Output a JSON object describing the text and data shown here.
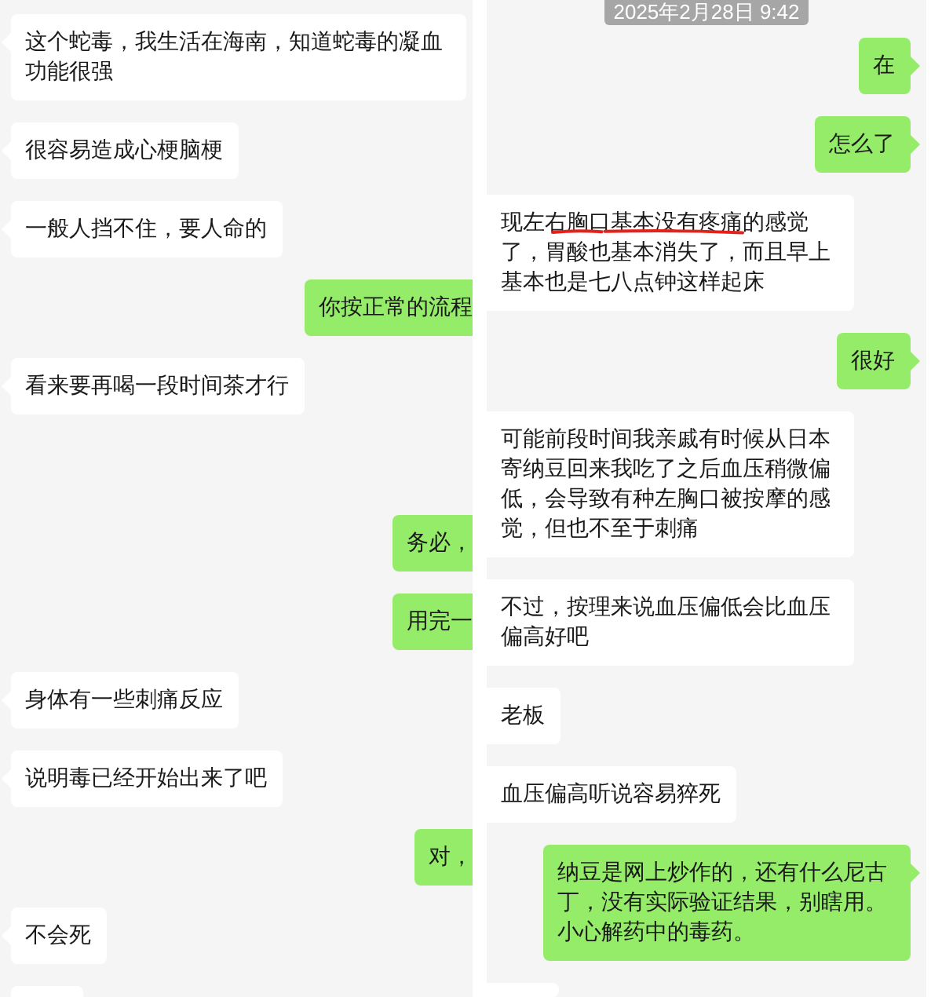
{
  "panels": [
    {
      "kind": "rightcut",
      "messages": [
        {
          "kind": "incoming",
          "text": "这个蛇毒，我生活在海南，知道蛇毒的凝血功能很强"
        },
        {
          "kind": "incoming",
          "text": "很容易造成心梗脑梗"
        },
        {
          "kind": "incoming",
          "text": "一般人挡不住，要人命的"
        },
        {
          "kind": "outgoing",
          "text": "你按正常的流程"
        },
        {
          "kind": "incoming",
          "text": "看来要再喝一段时间茶才行"
        },
        {
          "kind": "outgoing",
          "text": "务必，",
          "gap_before": true
        },
        {
          "kind": "outgoing",
          "text": "用完一"
        },
        {
          "kind": "incoming",
          "text": "身体有一些刺痛反应"
        },
        {
          "kind": "incoming",
          "text": "说明毒已经开始出来了吧"
        },
        {
          "kind": "outgoing",
          "text": "对，"
        },
        {
          "kind": "incoming",
          "text": "不会死"
        },
        {
          "kind": "incoming",
          "cut_off": true
        }
      ]
    },
    {
      "kind": "leftcut",
      "timestamp": "2025年2月28日 9:42",
      "messages": [
        {
          "kind": "outgoing",
          "text": "在"
        },
        {
          "kind": "outgoing",
          "text": "怎么了"
        },
        {
          "kind": "incoming",
          "segments": [
            {
              "text": "现左",
              "underlined": false
            },
            {
              "text": "右胸口基本没有疼痛",
              "underlined": true
            },
            {
              "text": "的感觉了，胃酸也基本消失了，而且早上基本也是七八点钟这样起床",
              "underlined": false
            }
          ]
        },
        {
          "kind": "outgoing",
          "text": "很好"
        },
        {
          "kind": "incoming",
          "text": "可能前段时间我亲戚有时候从日本寄纳豆回来我吃了之后血压稍微偏低，会导致有种左胸口被按摩的感觉，但也不至于刺痛"
        },
        {
          "kind": "incoming",
          "text": "不过，按理来说血压偏低会比血压偏高好吧"
        },
        {
          "kind": "incoming",
          "text": "老板"
        },
        {
          "kind": "incoming",
          "text": "血压偏高听说容易猝死"
        },
        {
          "kind": "outgoing",
          "text": "纳豆是网上炒作的，还有什么尼古丁，没有实际验证结果，别瞎用。小心解药中的毒药。"
        },
        {
          "kind": "incoming",
          "cut_off": true
        }
      ]
    }
  ]
}
